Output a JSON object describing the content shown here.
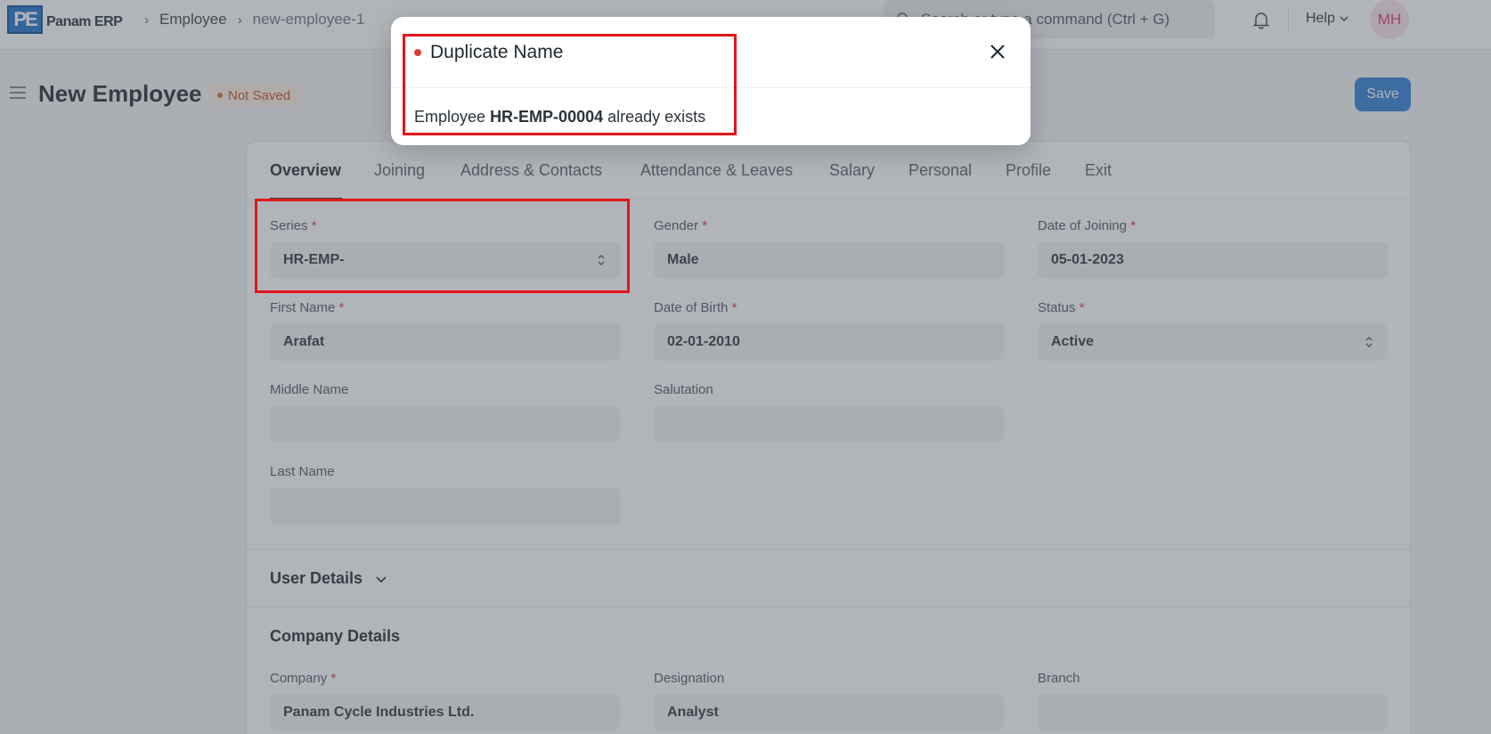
{
  "navbar": {
    "logo_mark": "PE",
    "logo_text": "Panam ERP",
    "breadcrumbs": [
      "Employee",
      "new-employee-1"
    ],
    "search_placeholder": "Search or type a command (Ctrl + G)",
    "help_label": "Help",
    "avatar_initials": "MH"
  },
  "page": {
    "title": "New Employee",
    "status": "Not Saved",
    "save_label": "Save"
  },
  "tabs": [
    "Overview",
    "Joining",
    "Address & Contacts",
    "Attendance & Leaves",
    "Salary",
    "Personal",
    "Profile",
    "Exit"
  ],
  "form": {
    "series": {
      "label": "Series",
      "value": "HR-EMP-"
    },
    "gender": {
      "label": "Gender",
      "value": "Male"
    },
    "date_of_joining": {
      "label": "Date of Joining",
      "value": "05-01-2023"
    },
    "first_name": {
      "label": "First Name",
      "value": "Arafat"
    },
    "date_of_birth": {
      "label": "Date of Birth",
      "value": "02-01-2010"
    },
    "status": {
      "label": "Status",
      "value": "Active"
    },
    "middle_name": {
      "label": "Middle Name",
      "value": ""
    },
    "salutation": {
      "label": "Salutation",
      "value": ""
    },
    "last_name": {
      "label": "Last Name",
      "value": ""
    }
  },
  "sections": {
    "user_details": "User Details",
    "company_details": "Company Details"
  },
  "company": {
    "company": {
      "label": "Company",
      "value": "Panam Cycle Industries Ltd."
    },
    "designation": {
      "label": "Designation",
      "value": "Analyst"
    },
    "branch": {
      "label": "Branch",
      "value": ""
    }
  },
  "modal": {
    "title": "Duplicate Name",
    "message_prefix": "Employee",
    "message_id": "HR-EMP-00004",
    "message_suffix": "already exists"
  },
  "colors": {
    "primary": "#2c7dd8",
    "annotation": "#e3161b",
    "required": "#e03131"
  }
}
